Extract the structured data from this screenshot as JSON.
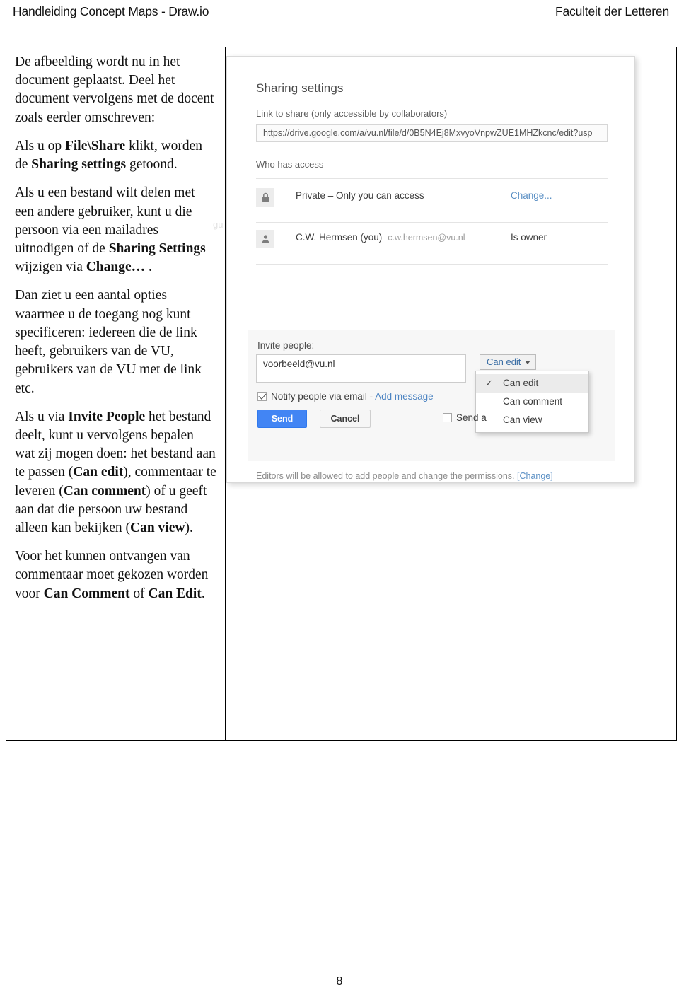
{
  "header": {
    "left": "Handleiding Concept Maps - Draw.io",
    "right": "Faculteit der Letteren"
  },
  "page_number": "8",
  "text_column": {
    "paragraphs": [
      {
        "id": "p1",
        "runs": [
          {
            "text": "De afbeelding wordt nu in het document geplaatst. Deel het document vervolgens met de docent zoals eerder omschreven:",
            "bold": false
          }
        ]
      },
      {
        "id": "p2",
        "runs": [
          {
            "text": "Als u op ",
            "bold": false
          },
          {
            "text": "File\\Share",
            "bold": true
          },
          {
            "text": " klikt, worden de ",
            "bold": false
          },
          {
            "text": "Sharing settings",
            "bold": true
          },
          {
            "text": " getoond.",
            "bold": false
          }
        ]
      },
      {
        "id": "p3",
        "runs": [
          {
            "text": "Als u een bestand wilt delen met een andere gebruiker, kunt u die persoon via een mailadres uitnodigen of de ",
            "bold": false
          },
          {
            "text": "Sharing Settings",
            "bold": true
          },
          {
            "text": " wijzigen via ",
            "bold": false
          },
          {
            "text": "Change…",
            "bold": true
          },
          {
            "text": " .",
            "bold": false
          }
        ]
      },
      {
        "id": "p4",
        "runs": [
          {
            "text": "Dan ziet u een aantal opties waarmee u de toegang nog kunt specificeren: iedereen die de link heeft, gebruikers van de VU, gebruikers van de VU met de link etc.",
            "bold": false
          }
        ]
      },
      {
        "id": "p5",
        "runs": [
          {
            "text": "Als u via ",
            "bold": false
          },
          {
            "text": "Invite People",
            "bold": true
          },
          {
            "text": " het bestand deelt, kunt u vervolgens bepalen wat zij mogen doen: het bestand aan te passen (",
            "bold": false
          },
          {
            "text": "Can edit",
            "bold": true
          },
          {
            "text": "), commentaar te leveren (",
            "bold": false
          },
          {
            "text": "Can comment",
            "bold": true
          },
          {
            "text": ") of u geeft aan dat die persoon uw bestand alleen kan bekijken (",
            "bold": false
          },
          {
            "text": "Can view",
            "bold": true
          },
          {
            "text": ").",
            "bold": false
          }
        ]
      },
      {
        "id": "p6",
        "runs": [
          {
            "text": "Voor het kunnen ontvangen van commentaar moet gekozen worden voor ",
            "bold": false
          },
          {
            "text": "Can Comment",
            "bold": true
          },
          {
            "text": " of ",
            "bold": false
          },
          {
            "text": "Can Edit",
            "bold": true
          },
          {
            "text": ".",
            "bold": false
          }
        ]
      }
    ]
  },
  "screenshot": {
    "ghost_text": "gu",
    "title": "Sharing settings",
    "link_label": "Link to share (only accessible by collaborators)",
    "link_value": "https://drive.google.com/a/vu.nl/file/d/0B5N4Ej8MxvyoVnpwZUE1MHZkcnc/edit?usp=",
    "who_has_access_label": "Who has access",
    "access_rows": [
      {
        "icon": "lock-icon",
        "main": "Private – Only you can access",
        "email": "",
        "action": "Change...",
        "action_is_link": true
      },
      {
        "icon": "person-icon",
        "main": "C.W. Hermsen (you)",
        "email": "c.w.hermsen@vu.nl",
        "action": "Is owner",
        "action_is_link": false
      }
    ],
    "invite": {
      "label": "Invite people:",
      "email_value": "voorbeeld@vu.nl",
      "permission_button": "Can edit",
      "permission_options": [
        {
          "label": "Can edit",
          "selected": true
        },
        {
          "label": "Can comment",
          "selected": false
        },
        {
          "label": "Can view",
          "selected": false
        }
      ],
      "notify_label": "Notify people via email",
      "notify_separator": " - ",
      "add_message_link": "Add message",
      "notify_checked": true,
      "send_button": "Send",
      "cancel_button": "Cancel",
      "send_copy_label": "Send a",
      "send_copy_checked": false
    },
    "footer_note": "Editors will be allowed to add people and change the permissions.",
    "footer_note_link": "[Change]"
  },
  "colors": {
    "send_button_blue": "#4285f4",
    "link_blue": "#5a8fc4",
    "border_black": "#000000"
  }
}
